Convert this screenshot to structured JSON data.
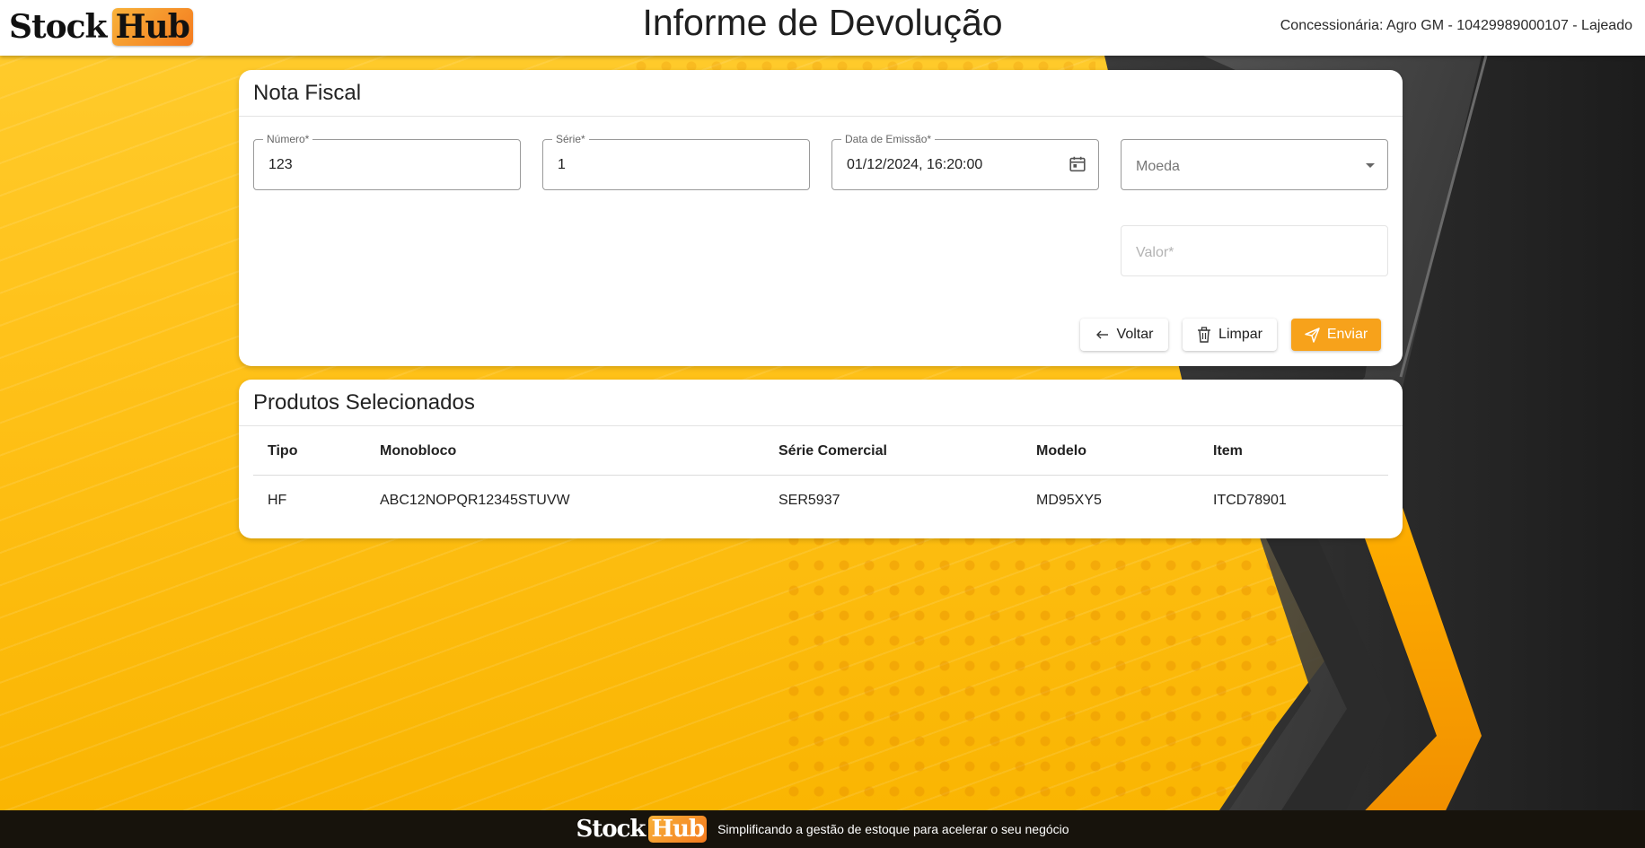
{
  "header": {
    "logo_part1": "Stock",
    "logo_part2": "Hub",
    "title": "Informe de Devolução",
    "dealer": "Concessionária: Agro GM - 10429989000107 - Lajeado"
  },
  "nota_fiscal": {
    "title": "Nota Fiscal",
    "numero": {
      "label": "Número*",
      "value": "123"
    },
    "serie": {
      "label": "Série*",
      "value": "1"
    },
    "data_emissao": {
      "label": "Data de Emissão*",
      "value": "01/12/2024, 16:20:00",
      "icon": "calendar-icon"
    },
    "moeda": {
      "placeholder": "Moeda",
      "icon": "chevron-down-icon"
    },
    "valor": {
      "placeholder": "Valor*"
    },
    "buttons": {
      "voltar": {
        "label": "Voltar",
        "icon": "arrow-left-icon"
      },
      "limpar": {
        "label": "Limpar",
        "icon": "trash-icon"
      },
      "enviar": {
        "label": "Enviar",
        "icon": "send-icon"
      }
    }
  },
  "produtos": {
    "title": "Produtos Selecionados",
    "columns": [
      "Tipo",
      "Monobloco",
      "Série Comercial",
      "Modelo",
      "Item"
    ],
    "rows": [
      [
        "HF",
        "ABC12NOPQR12345STUVW",
        "SER5937",
        "MD95XY5",
        "ITCD78901"
      ]
    ]
  },
  "footer": {
    "logo_part1": "Stock",
    "logo_part2": "Hub",
    "tagline": "Simplificando a gestão de estoque para acelerar o seu negócio"
  },
  "colors": {
    "accent": "#f7a21b",
    "background_yellow": "#ffc21a",
    "footer_bg": "#17130c"
  }
}
